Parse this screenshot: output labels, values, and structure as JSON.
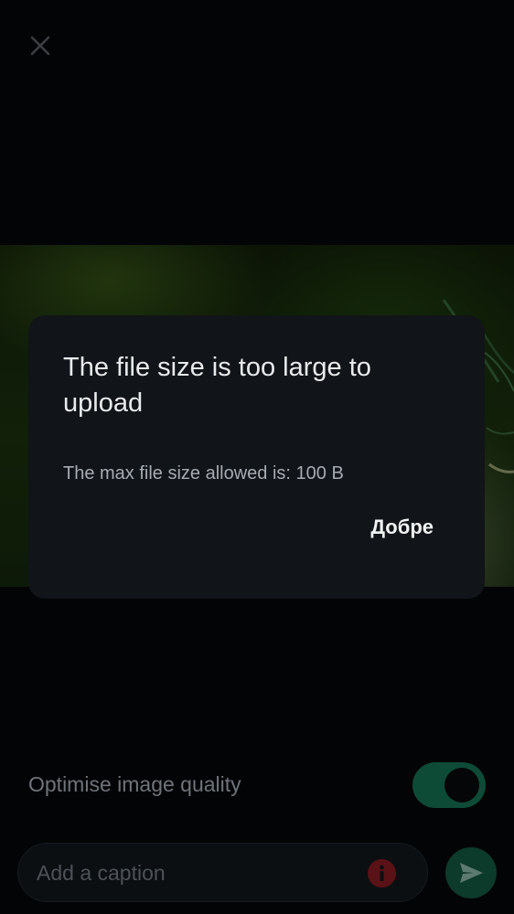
{
  "dialog": {
    "title": "The file size is too large to upload",
    "message": "The max file size allowed is: 100 B",
    "ok_label": "Добре"
  },
  "settings": {
    "optimise_label": "Optimise image quality",
    "optimise_enabled": true
  },
  "composer": {
    "caption_placeholder": "Add a caption",
    "caption_value": ""
  },
  "icons": {
    "close": "close-icon",
    "error": "error-icon",
    "send": "send-icon"
  },
  "colors": {
    "dialog_background": "#111418",
    "accent_green": "#0e4b37",
    "error_red": "#5a1216"
  }
}
